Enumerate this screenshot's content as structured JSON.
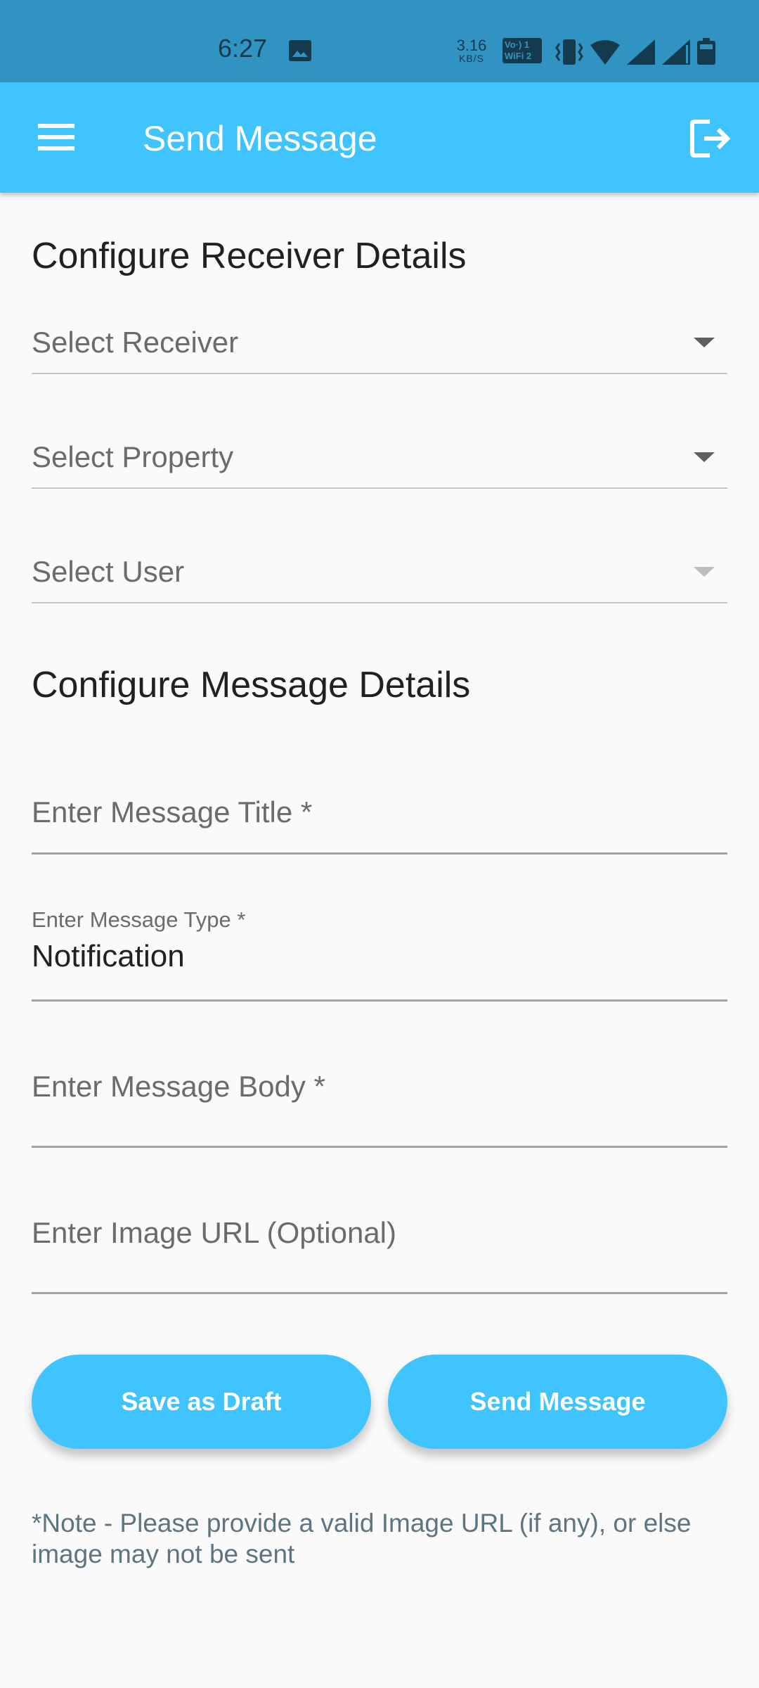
{
  "status_bar": {
    "time": "6:27",
    "net_speed_value": "3.16",
    "net_speed_unit": "KB/S",
    "volte_top": "Vo·) 1",
    "volte_bottom": "WiFi 2",
    "icons": [
      "photo-icon",
      "volte-wifi-icon",
      "vibrate-icon",
      "wifi-icon",
      "signal-icon",
      "signal-icon",
      "battery-icon"
    ]
  },
  "app_bar": {
    "title": "Send Message",
    "menu_icon": "hamburger-menu-icon",
    "logout_icon": "logout-icon",
    "background": "#40c4ff"
  },
  "receiver_section": {
    "title": "Configure Receiver Details",
    "dropdowns": [
      {
        "label": "Select Receiver",
        "enabled": true
      },
      {
        "label": "Select Property",
        "enabled": true
      },
      {
        "label": "Select User",
        "enabled": false
      }
    ]
  },
  "message_section": {
    "title": "Configure Message Details",
    "fields": [
      {
        "placeholder": "Enter Message Title *",
        "value": ""
      },
      {
        "label": "Enter Message Type *",
        "value": "Notification"
      },
      {
        "placeholder": "Enter Message Body *",
        "value": ""
      },
      {
        "placeholder": "Enter Image URL (Optional)",
        "value": ""
      }
    ]
  },
  "actions": {
    "save_draft_label": "Save as Draft",
    "send_label": "Send Message",
    "button_color": "#40c4ff"
  },
  "note": "*Note - Please provide a valid Image URL (if any), or else image may not be sent"
}
